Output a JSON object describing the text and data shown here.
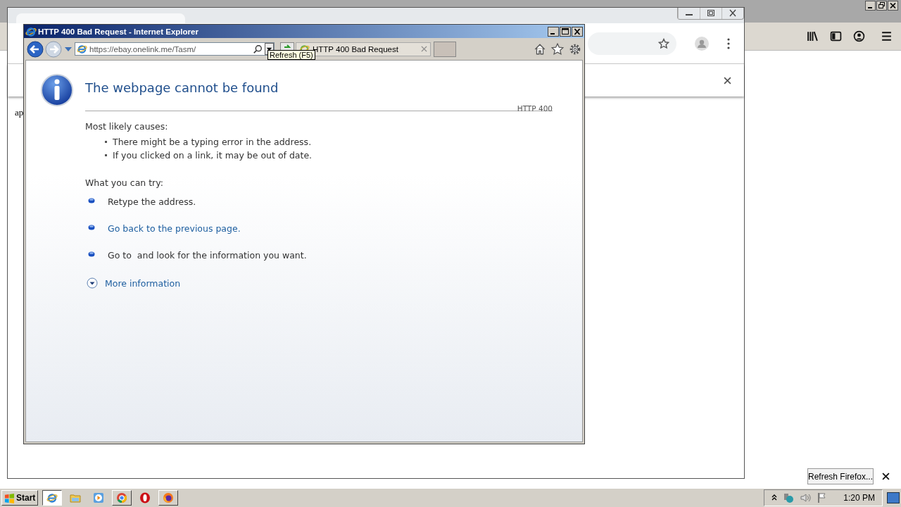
{
  "chrome": {
    "text_fragment": "ap"
  },
  "firefox": {
    "refresh_button": "Refresh Firefox..."
  },
  "ie": {
    "title": "HTTP 400 Bad Request - Internet Explorer",
    "address": "https://ebay.onelink.me/Tasm/",
    "tab": {
      "title": "HTTP 400 Bad Request",
      "selected": true
    },
    "tooltip": "Refresh (F5)",
    "page": {
      "heading": "The webpage cannot be found",
      "code": "HTTP 400",
      "causes_title": "Most likely causes:",
      "causes": [
        "There might be a typing error in the address.",
        "If you clicked on a link, it may be out of date."
      ],
      "try_title": "What you can try:",
      "try": [
        {
          "kind": "text",
          "text": "Retype the address."
        },
        {
          "kind": "link",
          "text": "Go back to the previous page."
        },
        {
          "kind": "text",
          "text": "Go to  and look for the information you want."
        }
      ],
      "more_info": "More information"
    }
  },
  "taskbar": {
    "start": "Start",
    "apps": [
      {
        "kind": "ie",
        "selected": true
      },
      {
        "kind": "folder",
        "selected": false
      },
      {
        "kind": "media",
        "selected": false
      },
      {
        "kind": "chrome",
        "selected": false
      },
      {
        "kind": "opera",
        "selected": false
      },
      {
        "kind": "firefox",
        "selected": false
      }
    ],
    "clock": "1:20 PM"
  }
}
